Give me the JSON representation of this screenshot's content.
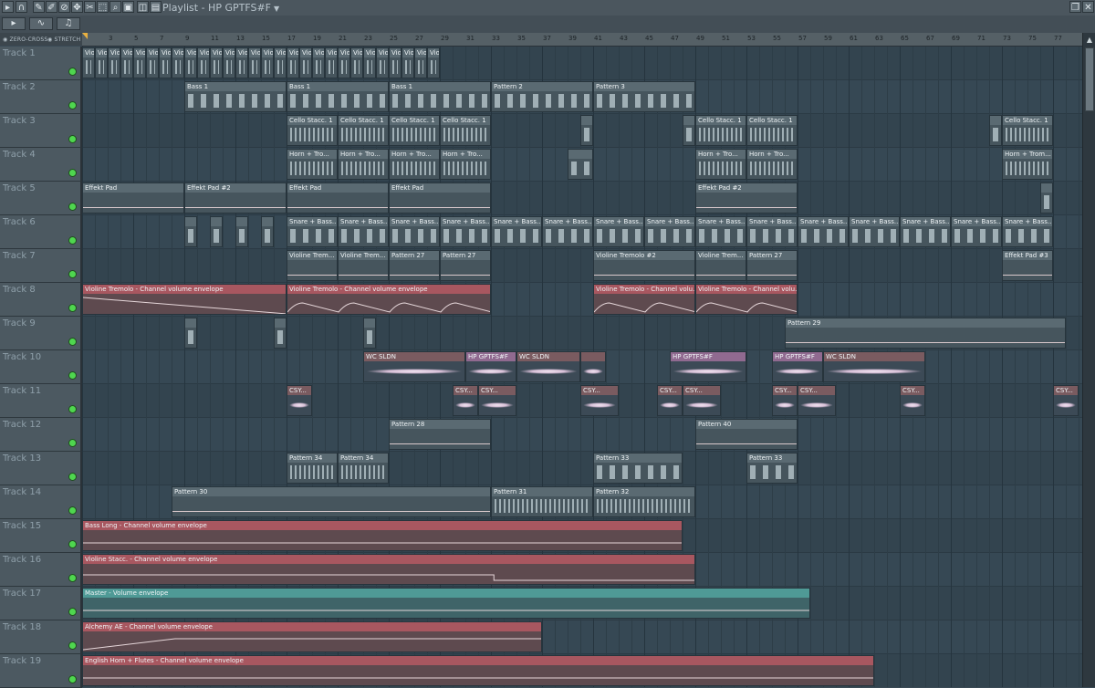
{
  "window": {
    "title": "Playlist - HP GPTFS#F"
  },
  "toolbar": {
    "zero_cross": "ZERO-CROSS",
    "stretch": "STRETCH"
  },
  "ruler": {
    "bars": [
      "3",
      "5",
      "7",
      "9",
      "11",
      "13",
      "15",
      "17",
      "19",
      "21",
      "23",
      "25",
      "27",
      "29",
      "31",
      "33",
      "35",
      "37",
      "39",
      "41",
      "43",
      "45",
      "47",
      "49",
      "51",
      "53",
      "55",
      "57",
      "59",
      "61",
      "63",
      "65",
      "67",
      "69",
      "71",
      "73",
      "75",
      "77"
    ]
  },
  "colors": {
    "pattern": "#5a6a72",
    "envelope": "#a85760",
    "master": "#4f9a96",
    "led": "#4fd64f"
  },
  "tracks": [
    {
      "name": "Track 1"
    },
    {
      "name": "Track 2"
    },
    {
      "name": "Track 3"
    },
    {
      "name": "Track 4"
    },
    {
      "name": "Track 5"
    },
    {
      "name": "Track 6"
    },
    {
      "name": "Track 7"
    },
    {
      "name": "Track 8"
    },
    {
      "name": "Track 9"
    },
    {
      "name": "Track 10"
    },
    {
      "name": "Track 11"
    },
    {
      "name": "Track 12"
    },
    {
      "name": "Track 13"
    },
    {
      "name": "Track 14"
    },
    {
      "name": "Track 15"
    },
    {
      "name": "Track 16"
    },
    {
      "name": "Track 17"
    },
    {
      "name": "Track 18"
    },
    {
      "name": "Track 19"
    }
  ],
  "clips": [
    {
      "track": 1,
      "start": 1,
      "end": 2,
      "label": "Viol..",
      "kind": "pat",
      "density": "dense"
    },
    {
      "track": 1,
      "start": 2,
      "end": 3,
      "label": "Viol..",
      "kind": "pat",
      "density": "dense"
    },
    {
      "track": 1,
      "start": 3,
      "end": 4,
      "label": "Viol..",
      "kind": "pat",
      "density": "dense"
    },
    {
      "track": 1,
      "start": 4,
      "end": 5,
      "label": "Viol..",
      "kind": "pat",
      "density": "dense"
    },
    {
      "track": 1,
      "start": 5,
      "end": 6,
      "label": "Viol..",
      "kind": "pat",
      "density": "dense"
    },
    {
      "track": 1,
      "start": 6,
      "end": 7,
      "label": "Viol..",
      "kind": "pat",
      "density": "dense"
    },
    {
      "track": 1,
      "start": 7,
      "end": 8,
      "label": "Viol..",
      "kind": "pat",
      "density": "dense"
    },
    {
      "track": 1,
      "start": 8,
      "end": 9,
      "label": "Viol..",
      "kind": "pat",
      "density": "dense"
    },
    {
      "track": 1,
      "start": 9,
      "end": 10,
      "label": "Viol..",
      "kind": "pat",
      "density": "dense"
    },
    {
      "track": 1,
      "start": 10,
      "end": 11,
      "label": "Viol..",
      "kind": "pat",
      "density": "dense"
    },
    {
      "track": 1,
      "start": 11,
      "end": 12,
      "label": "Viol..",
      "kind": "pat",
      "density": "dense"
    },
    {
      "track": 1,
      "start": 12,
      "end": 13,
      "label": "Viol..",
      "kind": "pat",
      "density": "dense"
    },
    {
      "track": 1,
      "start": 13,
      "end": 14,
      "label": "Viol..",
      "kind": "pat",
      "density": "dense"
    },
    {
      "track": 1,
      "start": 14,
      "end": 15,
      "label": "Viol..",
      "kind": "pat",
      "density": "dense"
    },
    {
      "track": 1,
      "start": 15,
      "end": 16,
      "label": "Viol..",
      "kind": "pat",
      "density": "dense"
    },
    {
      "track": 1,
      "start": 16,
      "end": 17,
      "label": "Viol..",
      "kind": "pat",
      "density": "dense"
    },
    {
      "track": 1,
      "start": 17,
      "end": 18,
      "label": "Viol..",
      "kind": "pat",
      "density": "dense"
    },
    {
      "track": 1,
      "start": 18,
      "end": 19,
      "label": "Viol..",
      "kind": "pat",
      "density": "dense"
    },
    {
      "track": 1,
      "start": 19,
      "end": 20,
      "label": "Viol..",
      "kind": "pat",
      "density": "dense"
    },
    {
      "track": 1,
      "start": 20,
      "end": 21,
      "label": "Viol..",
      "kind": "pat",
      "density": "dense"
    },
    {
      "track": 1,
      "start": 21,
      "end": 22,
      "label": "Viol..",
      "kind": "pat",
      "density": "dense"
    },
    {
      "track": 1,
      "start": 22,
      "end": 23,
      "label": "Viol..",
      "kind": "pat",
      "density": "dense"
    },
    {
      "track": 1,
      "start": 23,
      "end": 24,
      "label": "Viol..",
      "kind": "pat",
      "density": "dense"
    },
    {
      "track": 1,
      "start": 24,
      "end": 25,
      "label": "Viol..",
      "kind": "pat",
      "density": "dense"
    },
    {
      "track": 1,
      "start": 25,
      "end": 26,
      "label": "Viol..",
      "kind": "pat",
      "density": "dense"
    },
    {
      "track": 1,
      "start": 26,
      "end": 27,
      "label": "Viol..",
      "kind": "pat",
      "density": "dense"
    },
    {
      "track": 1,
      "start": 27,
      "end": 28,
      "label": "Viol..",
      "kind": "pat",
      "density": "dense"
    },
    {
      "track": 1,
      "start": 28,
      "end": 29,
      "label": "Viol..",
      "kind": "pat",
      "density": "dense"
    },
    {
      "track": 2,
      "start": 9,
      "end": 17,
      "label": "Bass 1",
      "kind": "pat",
      "density": "sparse"
    },
    {
      "track": 2,
      "start": 17,
      "end": 25,
      "label": "Bass 1",
      "kind": "pat",
      "density": "sparse"
    },
    {
      "track": 2,
      "start": 25,
      "end": 33,
      "label": "Bass 1",
      "kind": "pat",
      "density": "sparse"
    },
    {
      "track": 2,
      "start": 33,
      "end": 41,
      "label": "Pattern 2",
      "kind": "pat",
      "density": "sparse"
    },
    {
      "track": 2,
      "start": 41,
      "end": 49,
      "label": "Pattern 3",
      "kind": "pat",
      "density": "sparse"
    },
    {
      "track": 3,
      "start": 17,
      "end": 21,
      "label": "Cello Stacc. 1",
      "kind": "pat",
      "density": "dense"
    },
    {
      "track": 3,
      "start": 21,
      "end": 25,
      "label": "Cello Stacc. 1",
      "kind": "pat",
      "density": "dense"
    },
    {
      "track": 3,
      "start": 25,
      "end": 29,
      "label": "Cello Stacc. 1",
      "kind": "pat",
      "density": "dense"
    },
    {
      "track": 3,
      "start": 29,
      "end": 33,
      "label": "Cello Stacc. 1",
      "kind": "pat",
      "density": "dense"
    },
    {
      "track": 3,
      "start": 40,
      "end": 41,
      "label": "",
      "kind": "pat",
      "density": "sparse"
    },
    {
      "track": 3,
      "start": 48,
      "end": 49,
      "label": "",
      "kind": "pat",
      "density": "sparse"
    },
    {
      "track": 3,
      "start": 49,
      "end": 53,
      "label": "Cello Stacc. 1",
      "kind": "pat",
      "density": "dense"
    },
    {
      "track": 3,
      "start": 53,
      "end": 57,
      "label": "Cello Stacc. 1",
      "kind": "pat",
      "density": "dense"
    },
    {
      "track": 3,
      "start": 72,
      "end": 73,
      "label": "",
      "kind": "pat",
      "density": "sparse"
    },
    {
      "track": 3,
      "start": 73,
      "end": 77,
      "label": "Cello Stacc. 1",
      "kind": "pat",
      "density": "dense"
    },
    {
      "track": 4,
      "start": 17,
      "end": 21,
      "label": "Horn + Tro...",
      "kind": "pat",
      "density": "dense"
    },
    {
      "track": 4,
      "start": 21,
      "end": 25,
      "label": "Horn + Tro...",
      "kind": "pat",
      "density": "dense"
    },
    {
      "track": 4,
      "start": 25,
      "end": 29,
      "label": "Horn + Tro...",
      "kind": "pat",
      "density": "dense"
    },
    {
      "track": 4,
      "start": 29,
      "end": 33,
      "label": "Horn + Tro...",
      "kind": "pat",
      "density": "dense"
    },
    {
      "track": 4,
      "start": 39,
      "end": 41,
      "label": "",
      "kind": "pat",
      "density": "sparse"
    },
    {
      "track": 4,
      "start": 49,
      "end": 53,
      "label": "Horn + Tro...",
      "kind": "pat",
      "density": "dense"
    },
    {
      "track": 4,
      "start": 53,
      "end": 57,
      "label": "Horn + Tro...",
      "kind": "pat",
      "density": "dense"
    },
    {
      "track": 4,
      "start": 73,
      "end": 77,
      "label": "Horn + Trom...",
      "kind": "pat",
      "density": "dense"
    },
    {
      "track": 5,
      "start": 1,
      "end": 9,
      "label": "Effekt Pad",
      "kind": "pat",
      "density": "line"
    },
    {
      "track": 5,
      "start": 9,
      "end": 17,
      "label": "Effekt Pad #2",
      "kind": "pat",
      "density": "line"
    },
    {
      "track": 5,
      "start": 17,
      "end": 25,
      "label": "Effekt Pad",
      "kind": "pat",
      "density": "line"
    },
    {
      "track": 5,
      "start": 25,
      "end": 33,
      "label": "Effekt Pad",
      "kind": "pat",
      "density": "line"
    },
    {
      "track": 5,
      "start": 49,
      "end": 57,
      "label": "Effekt Pad #2",
      "kind": "pat",
      "density": "line"
    },
    {
      "track": 5,
      "start": 76,
      "end": 77,
      "label": "",
      "kind": "pat",
      "density": "sparse"
    },
    {
      "track": 6,
      "start": 9,
      "end": 10,
      "label": "",
      "kind": "pat",
      "density": "sparse"
    },
    {
      "track": 6,
      "start": 11,
      "end": 12,
      "label": "",
      "kind": "pat",
      "density": "sparse"
    },
    {
      "track": 6,
      "start": 13,
      "end": 14,
      "label": "",
      "kind": "pat",
      "density": "sparse"
    },
    {
      "track": 6,
      "start": 15,
      "end": 16,
      "label": "",
      "kind": "pat",
      "density": "sparse"
    },
    {
      "track": 6,
      "start": 17,
      "end": 21,
      "label": "Snare + Bass...",
      "kind": "pat",
      "density": "sparse"
    },
    {
      "track": 6,
      "start": 21,
      "end": 25,
      "label": "Snare + Bass...",
      "kind": "pat",
      "density": "sparse"
    },
    {
      "track": 6,
      "start": 25,
      "end": 29,
      "label": "Snare + Bass...",
      "kind": "pat",
      "density": "sparse"
    },
    {
      "track": 6,
      "start": 29,
      "end": 33,
      "label": "Snare + Bass...",
      "kind": "pat",
      "density": "sparse"
    },
    {
      "track": 6,
      "start": 33,
      "end": 37,
      "label": "Snare + Bass...",
      "kind": "pat",
      "density": "sparse"
    },
    {
      "track": 6,
      "start": 37,
      "end": 41,
      "label": "Snare + Bass...",
      "kind": "pat",
      "density": "sparse"
    },
    {
      "track": 6,
      "start": 41,
      "end": 45,
      "label": "Snare + Bass...",
      "kind": "pat",
      "density": "sparse"
    },
    {
      "track": 6,
      "start": 45,
      "end": 49,
      "label": "Snare + Bass...",
      "kind": "pat",
      "density": "sparse"
    },
    {
      "track": 6,
      "start": 49,
      "end": 53,
      "label": "Snare + Bass...",
      "kind": "pat",
      "density": "sparse"
    },
    {
      "track": 6,
      "start": 53,
      "end": 57,
      "label": "Snare + Bass...",
      "kind": "pat",
      "density": "sparse"
    },
    {
      "track": 6,
      "start": 57,
      "end": 61,
      "label": "Snare + Bass...",
      "kind": "pat",
      "density": "sparse"
    },
    {
      "track": 6,
      "start": 61,
      "end": 65,
      "label": "Snare + Bass...",
      "kind": "pat",
      "density": "sparse"
    },
    {
      "track": 6,
      "start": 65,
      "end": 69,
      "label": "Snare + Bass...",
      "kind": "pat",
      "density": "sparse"
    },
    {
      "track": 6,
      "start": 69,
      "end": 73,
      "label": "Snare + Bass...",
      "kind": "pat",
      "density": "sparse"
    },
    {
      "track": 6,
      "start": 73,
      "end": 77,
      "label": "Snare + Bass...",
      "kind": "pat",
      "density": "sparse"
    },
    {
      "track": 7,
      "start": 17,
      "end": 21,
      "label": "Violine Trem...",
      "kind": "pat",
      "density": "line"
    },
    {
      "track": 7,
      "start": 21,
      "end": 25,
      "label": "Violine Trem...",
      "kind": "pat",
      "density": "line"
    },
    {
      "track": 7,
      "start": 25,
      "end": 29,
      "label": "Pattern 27",
      "kind": "pat",
      "density": "line"
    },
    {
      "track": 7,
      "start": 29,
      "end": 33,
      "label": "Pattern 27",
      "kind": "pat",
      "density": "line"
    },
    {
      "track": 7,
      "start": 41,
      "end": 49,
      "label": "Violine Tremolo #2",
      "kind": "pat",
      "density": "line"
    },
    {
      "track": 7,
      "start": 49,
      "end": 53,
      "label": "Violine Trem...",
      "kind": "pat",
      "density": "line"
    },
    {
      "track": 7,
      "start": 53,
      "end": 57,
      "label": "Pattern 27",
      "kind": "pat",
      "density": "line"
    },
    {
      "track": 7,
      "start": 73,
      "end": 77,
      "label": "Effekt Pad #3",
      "kind": "pat",
      "density": "line"
    },
    {
      "track": 8,
      "start": 1,
      "end": 17,
      "label": "Violine Tremolo - Channel volume envelope",
      "kind": "env",
      "shape": "ramp"
    },
    {
      "track": 8,
      "start": 17,
      "end": 33,
      "label": "Violine Tremolo - Channel volume envelope",
      "kind": "env",
      "shape": "wave"
    },
    {
      "track": 8,
      "start": 41,
      "end": 49,
      "label": "Violine Tremolo - Channel volu...",
      "kind": "env",
      "shape": "wave"
    },
    {
      "track": 8,
      "start": 49,
      "end": 57,
      "label": "Violine Tremolo - Channel volu...",
      "kind": "env",
      "shape": "wave"
    },
    {
      "track": 9,
      "start": 9,
      "end": 10,
      "label": "",
      "kind": "pat",
      "density": "sparse"
    },
    {
      "track": 9,
      "start": 16,
      "end": 17,
      "label": "",
      "kind": "pat",
      "density": "sparse"
    },
    {
      "track": 9,
      "start": 23,
      "end": 24,
      "label": "",
      "kind": "pat",
      "density": "sparse"
    },
    {
      "track": 9,
      "start": 56,
      "end": 78,
      "label": "Pattern 29",
      "kind": "pat",
      "density": "line"
    },
    {
      "track": 10,
      "start": 23,
      "end": 31,
      "label": "WC SLDN",
      "kind": "audio",
      "color": "normal"
    },
    {
      "track": 10,
      "start": 31,
      "end": 35,
      "label": "HP GPTFS#F",
      "kind": "audio",
      "color": "pink"
    },
    {
      "track": 10,
      "start": 35,
      "end": 40,
      "label": "WC SLDN",
      "kind": "audio",
      "color": "normal"
    },
    {
      "track": 10,
      "start": 40,
      "end": 42,
      "label": "",
      "kind": "audio",
      "color": "normal"
    },
    {
      "track": 10,
      "start": 47,
      "end": 53,
      "label": "HP GPTFS#F",
      "kind": "audio",
      "color": "pink"
    },
    {
      "track": 10,
      "start": 55,
      "end": 59,
      "label": "HP GPTFS#F",
      "kind": "audio",
      "color": "pink"
    },
    {
      "track": 10,
      "start": 59,
      "end": 67,
      "label": "WC SLDN",
      "kind": "audio",
      "color": "normal"
    },
    {
      "track": 11,
      "start": 17,
      "end": 19,
      "label": "CSY...",
      "kind": "audio",
      "color": "normal"
    },
    {
      "track": 11,
      "start": 30,
      "end": 32,
      "label": "CSY...",
      "kind": "audio",
      "color": "normal"
    },
    {
      "track": 11,
      "start": 32,
      "end": 35,
      "label": "CSY...",
      "kind": "audio",
      "color": "normal"
    },
    {
      "track": 11,
      "start": 40,
      "end": 43,
      "label": "CSY...",
      "kind": "audio",
      "color": "normal"
    },
    {
      "track": 11,
      "start": 46,
      "end": 48,
      "label": "CSY...",
      "kind": "audio",
      "color": "normal"
    },
    {
      "track": 11,
      "start": 48,
      "end": 51,
      "label": "CSY...",
      "kind": "audio",
      "color": "normal"
    },
    {
      "track": 11,
      "start": 55,
      "end": 57,
      "label": "CSY...",
      "kind": "audio",
      "color": "normal"
    },
    {
      "track": 11,
      "start": 57,
      "end": 60,
      "label": "CSY...",
      "kind": "audio",
      "color": "normal"
    },
    {
      "track": 11,
      "start": 65,
      "end": 67,
      "label": "CSY...",
      "kind": "audio",
      "color": "normal"
    },
    {
      "track": 11,
      "start": 77,
      "end": 79,
      "label": "CSY...",
      "kind": "audio",
      "color": "normal"
    },
    {
      "track": 12,
      "start": 25,
      "end": 33,
      "label": "Pattern 28",
      "kind": "pat",
      "density": "line"
    },
    {
      "track": 12,
      "start": 49,
      "end": 57,
      "label": "Pattern 40",
      "kind": "pat",
      "density": "line"
    },
    {
      "track": 13,
      "start": 17,
      "end": 21,
      "label": "Pattern 34",
      "kind": "pat",
      "density": "dense"
    },
    {
      "track": 13,
      "start": 21,
      "end": 25,
      "label": "Pattern 34",
      "kind": "pat",
      "density": "dense"
    },
    {
      "track": 13,
      "start": 41,
      "end": 48,
      "label": "Pattern 33",
      "kind": "pat",
      "density": "sparse"
    },
    {
      "track": 13,
      "start": 53,
      "end": 57,
      "label": "Pattern 33",
      "kind": "pat",
      "density": "sparse"
    },
    {
      "track": 14,
      "start": 8,
      "end": 33,
      "label": "Pattern 30",
      "kind": "pat",
      "density": "line"
    },
    {
      "track": 14,
      "start": 33,
      "end": 41,
      "label": "Pattern 31",
      "kind": "pat",
      "density": "dense"
    },
    {
      "track": 14,
      "start": 41,
      "end": 49,
      "label": "Pattern 32",
      "kind": "pat",
      "density": "dense"
    },
    {
      "track": 15,
      "start": 1,
      "end": 48,
      "label": "Bass Long - Channel volume envelope",
      "kind": "env",
      "shape": "flat"
    },
    {
      "track": 16,
      "start": 1,
      "end": 49,
      "label": "Violine Stacc. - Channel volume envelope",
      "kind": "env",
      "shape": "step"
    },
    {
      "track": 17,
      "start": 1,
      "end": 58,
      "label": "Master - Volume envelope",
      "kind": "master",
      "shape": "flat"
    },
    {
      "track": 18,
      "start": 1,
      "end": 37,
      "label": "Alchemy AE - Channel volume envelope",
      "kind": "env",
      "shape": "rise"
    },
    {
      "track": 19,
      "start": 1,
      "end": 63,
      "label": "English Horn + Flutes - Channel volume envelope",
      "kind": "env",
      "shape": "flat"
    }
  ]
}
